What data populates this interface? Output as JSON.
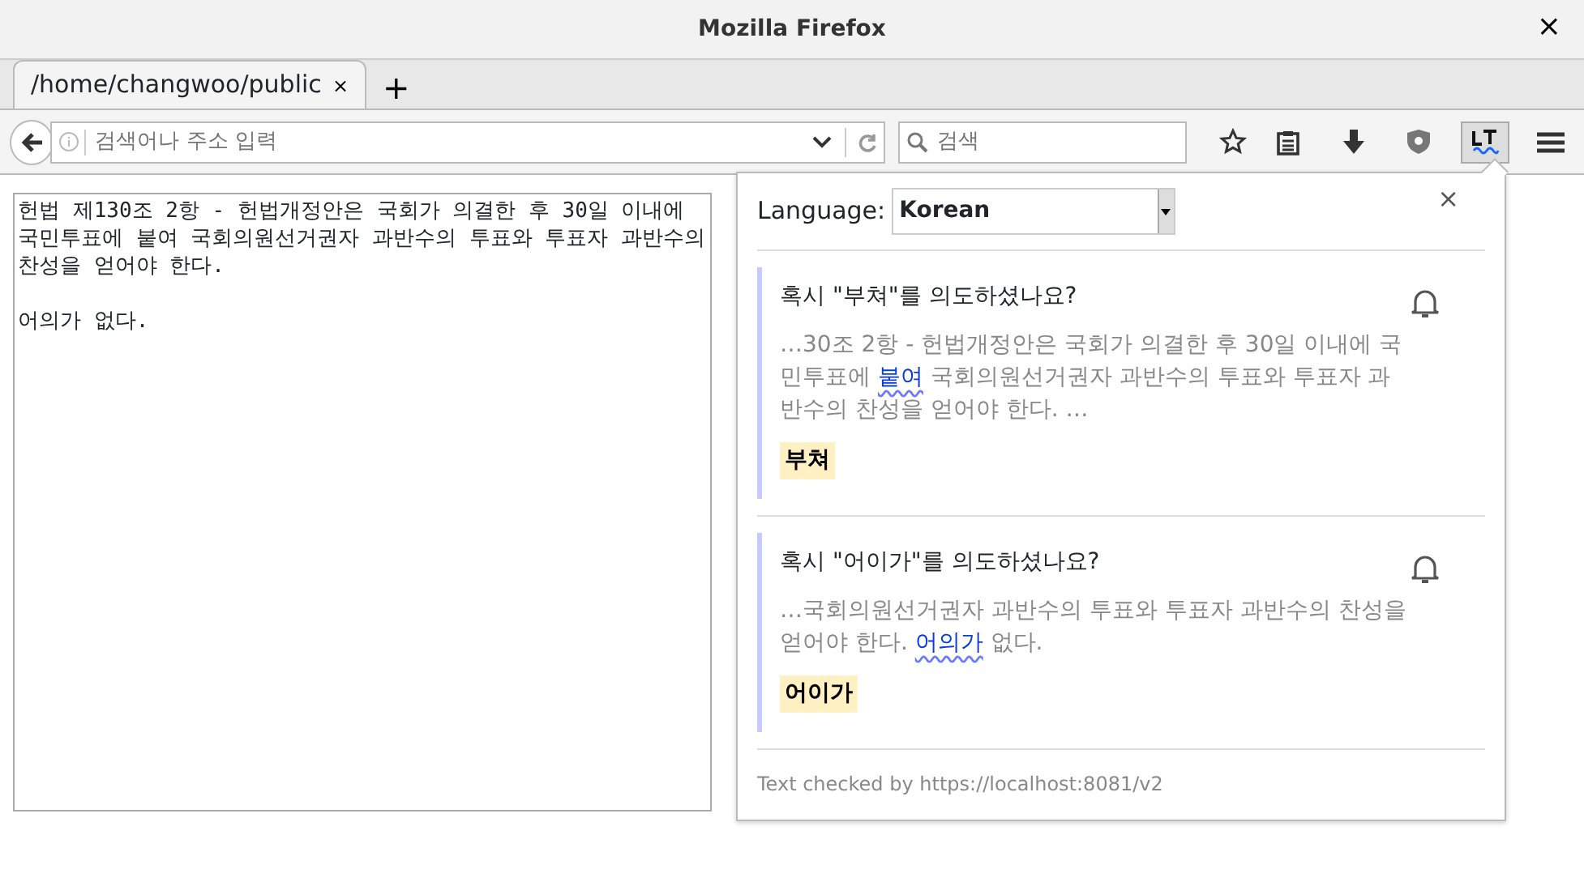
{
  "window": {
    "title": "Mozilla Firefox",
    "close": "×"
  },
  "tabs": [
    {
      "label": "/home/changwoo/public",
      "selected": true,
      "close": "×"
    }
  ],
  "new_tab": "+",
  "url_bar": {
    "placeholder": "검색어나 주소 입력"
  },
  "search": {
    "placeholder": "검색"
  },
  "editor": {
    "paragraphs": [
      "헌법 제130조 2항 - 헌법개정안은 국회가 의결한 후 30일 이내에 국민투표에 붙여 국회의원선거권자 과반수의 투표와 투표자 과반수의 찬성을 얻어야 한다.",
      "어의가 없다."
    ]
  },
  "popup": {
    "language_label": "Language:",
    "language": "Korean",
    "close": "×",
    "matches": [
      {
        "message": "혹시 \"부쳐\"를 의도하셨나요?",
        "before": "…30조 2항 - 헌법개정안은 국회가 의결한 후 30일 이내에 국민투표에 ",
        "error": "붙여",
        "after": " 국회의원선거권자 과반수의 투표와 투표자 과반수의 찬성을 얻어야 한다. …",
        "suggestion": "부쳐"
      },
      {
        "message": "혹시 \"어이가\"를 의도하셨나요?",
        "before": "…국회의원선거권자 과반수의 투표와 투표자 과반수의 찬성을 얻어야 한다. ",
        "error": "어의가",
        "after": " 없다.",
        "suggestion": "어이가"
      }
    ],
    "footer": "Text checked by https://localhost:8081/v2"
  }
}
